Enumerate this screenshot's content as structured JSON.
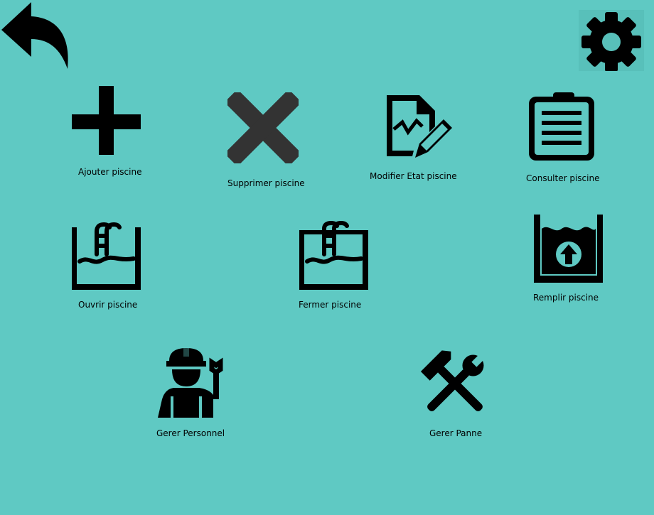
{
  "window": {
    "background": "#5fc9c3"
  },
  "top_bar": {
    "back_icon": "back-arrow-icon",
    "settings_icon": "gear-icon"
  },
  "actions": {
    "add_pool": {
      "label": "Ajouter piscine",
      "icon": "plus-icon"
    },
    "delete_pool": {
      "label": "Supprimer piscine",
      "icon": "cross-icon"
    },
    "edit_pool_state": {
      "label": "Modifier Etat piscine",
      "icon": "document-edit-icon"
    },
    "view_pool": {
      "label": "Consulter piscine",
      "icon": "clipboard-icon"
    },
    "open_pool": {
      "label": "Ouvrir piscine",
      "icon": "pool-ladder-icon"
    },
    "close_pool": {
      "label": "Fermer piscine",
      "icon": "pool-ladder-icon"
    },
    "fill_pool": {
      "label": "Remplir piscine",
      "icon": "pool-fill-icon"
    },
    "manage_staff": {
      "label": "Gerer Personnel",
      "icon": "worker-icon"
    },
    "manage_breakdown": {
      "label": "Gerer Panne",
      "icon": "tools-icon"
    }
  },
  "colors": {
    "icon_black": "#000000",
    "icon_dark_gray": "#333333"
  }
}
